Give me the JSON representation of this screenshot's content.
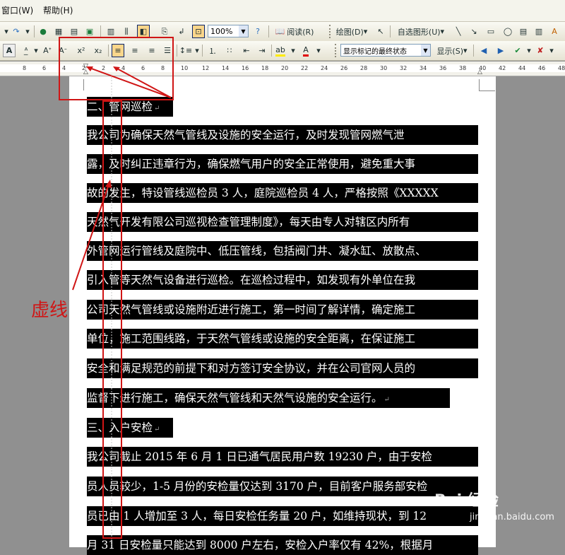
{
  "menu": {
    "items": [
      "窗口(W)",
      "帮助(H)"
    ]
  },
  "toolbar1": {
    "zoom_value": "100%",
    "read_label": "阅读(R)",
    "draw_label": "绘图(D)",
    "autoshape_label": "自选图形(U)"
  },
  "toolbar2": {
    "superscript": "x²",
    "subscript": "x₂",
    "markup_state": "显示标记的最终状态",
    "show_label": "显示(S)"
  },
  "ruler": {
    "ticks": [
      "8",
      "6",
      "4",
      "2",
      "2",
      "4",
      "6",
      "8",
      "10",
      "12",
      "14",
      "16",
      "18",
      "20",
      "22",
      "24",
      "26",
      "28",
      "30",
      "32",
      "34",
      "36",
      "38",
      "40",
      "42",
      "44",
      "46",
      "48"
    ]
  },
  "document": {
    "lines": [
      {
        "text": "二、管网巡检",
        "mark": "↵"
      },
      {
        "text": "我公司为确保天然气管线及设施的安全运行，及时发现管网燃气泄"
      },
      {
        "text": "露，及时纠正违章行为，确保燃气用户的安全正常使用，避免重大事"
      },
      {
        "text": "故的发生，特设管线巡检员 3 人，庭院巡检员 4 人，严格按照《XXXXX"
      },
      {
        "text": "天然气开发有限公司巡视检查管理制度》，每天由专人对辖区内所有"
      },
      {
        "text": "外管网运行管线及庭院中、低压管线，包括阀门井、凝水缸、放散点、"
      },
      {
        "text": "引入管等天然气设备进行巡检。在巡检过程中，如发现有外单位在我"
      },
      {
        "text": "公司天然气管线或设施附近进行施工，第一时间了解详情，确定施工"
      },
      {
        "text": "单位，施工范围线路，于天然气管线或设施的安全距离，在保证施工"
      },
      {
        "text": "安全和满足规范的前提下和对方签订安全协议，并在公司官网人员的"
      },
      {
        "text": "监督下进行施工，确保天然气管线和天然气设施的安全运行。",
        "mark": "↵"
      },
      {
        "text": "三、入户安检",
        "mark": "↵"
      },
      {
        "text": "我公司截止 2015 年 6 月 1 日已通气居民用户数 19230 户，由于安检"
      },
      {
        "text": "员人员较少，1-5 月份的安检量仅达到 3170 户，目前客户服务部安检"
      },
      {
        "text": "员已由 1 人增加至 3 人，每日安检任务量 20 户，如维持现状，到 12"
      },
      {
        "text": "月 31 日安检量只能达到 8000 户左右，安检入户率仅有 42%，根据月"
      }
    ]
  },
  "annotation": {
    "label": "虚线"
  },
  "watermark": {
    "brand": "Bai 经验",
    "url": "jingyan.baidu.com"
  }
}
